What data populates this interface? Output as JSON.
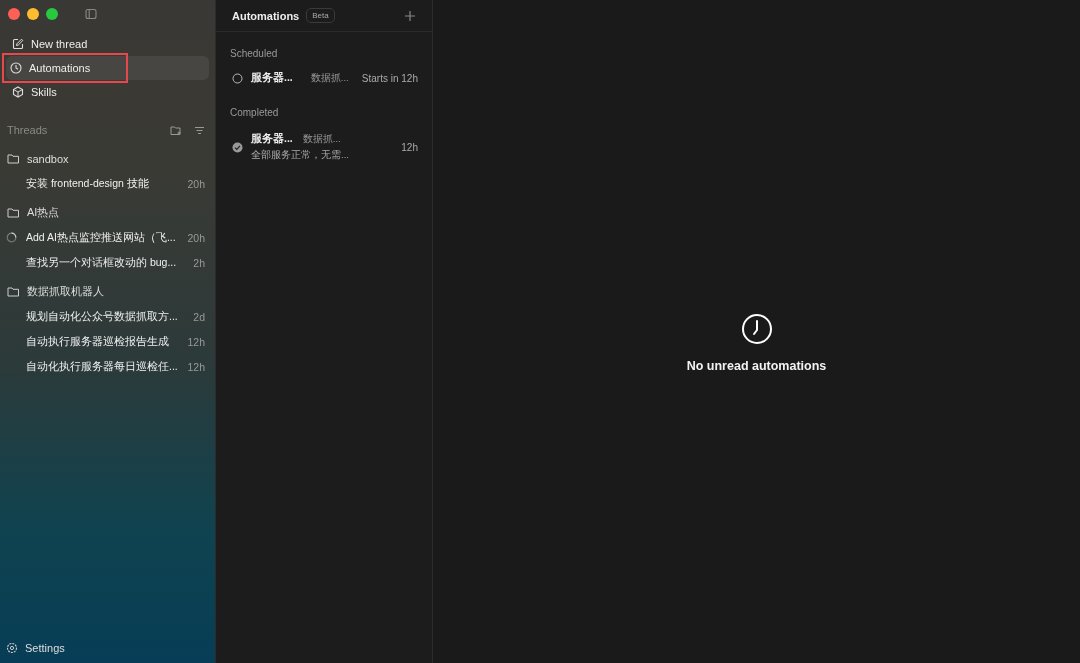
{
  "nav": [
    {
      "label": "New thread",
      "kind": "compose",
      "selected": false,
      "annotated": false
    },
    {
      "label": "Automations",
      "kind": "schedule",
      "selected": true,
      "annotated": true
    },
    {
      "label": "Skills",
      "kind": "library",
      "selected": false,
      "annotated": false
    }
  ],
  "threads": {
    "title": "Threads",
    "groups": [
      {
        "name": "sandbox",
        "children": [
          {
            "title": "安装 frontend-design 技能",
            "time": "20h",
            "running": false
          }
        ]
      },
      {
        "name": "AI热点",
        "children": [
          {
            "title": "Add AI热点监控推送网站（飞...",
            "time": "20h",
            "running": true
          },
          {
            "title": "查找另一个对话框改动的 bug...",
            "time": "2h",
            "running": false
          }
        ]
      },
      {
        "name": "数据抓取机器人",
        "children": [
          {
            "title": "规划自动化公众号数据抓取方...",
            "time": "2d",
            "running": false
          },
          {
            "title": "自动执行服务器巡检报告生成",
            "time": "12h",
            "running": false
          },
          {
            "title": "自动化执行服务器每日巡检任...",
            "time": "12h",
            "running": false
          }
        ]
      }
    ]
  },
  "settings": {
    "label": "Settings"
  },
  "automations": {
    "title": "Automations",
    "badge": "Beta",
    "sections": [
      {
        "title": "Scheduled",
        "items": [
          {
            "kind": "scheduled",
            "name": "服务器...",
            "project": "数据抓...",
            "time": "Starts in 12h"
          }
        ]
      },
      {
        "title": "Completed",
        "items": [
          {
            "kind": "completed",
            "name": "服务器...",
            "project": "数据抓...",
            "summary": "全部服务正常，无需...",
            "time": "12h"
          }
        ]
      }
    ]
  },
  "empty_state": {
    "message": "No unread automations"
  }
}
